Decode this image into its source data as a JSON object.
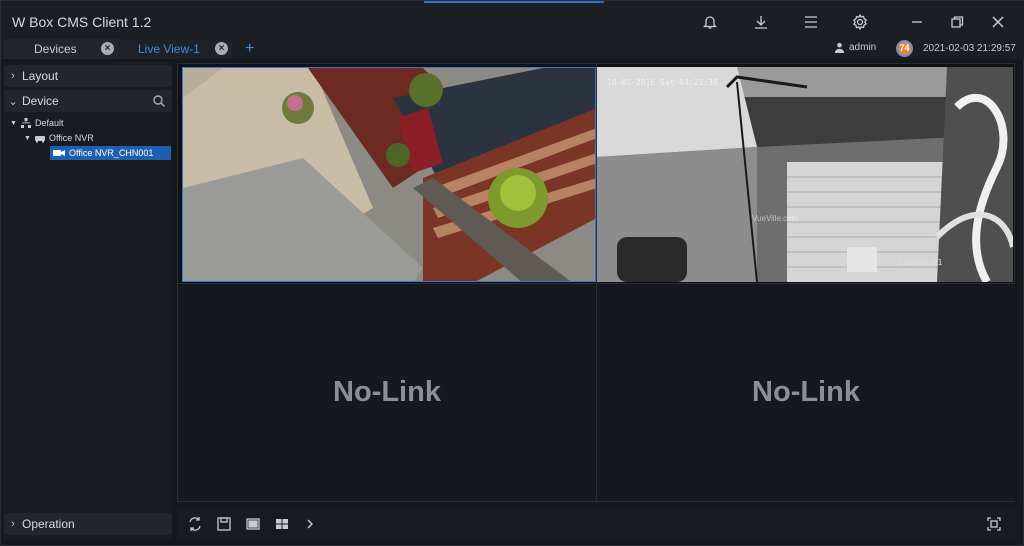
{
  "app": {
    "title": "W Box CMS Client 1.2"
  },
  "tabs": [
    {
      "label": "Devices"
    },
    {
      "label": "Live View-1"
    }
  ],
  "tab_add_label": "+",
  "user": {
    "name": "admin",
    "badge": "74",
    "datetime": "2021-02-03 21:29:57"
  },
  "sidebar": {
    "layout_label": "Layout",
    "device_label": "Device",
    "operation_label": "Operation",
    "tree": [
      {
        "label": "Default"
      },
      {
        "label": "Office NVR"
      },
      {
        "label": "Office NVR_CHN001"
      }
    ]
  },
  "views": {
    "cam2_osd": "10-01-2016 Sat 04:21:30",
    "cam2_name": "Camera 01",
    "cam2_watermark": "VueVille.com",
    "nolink_label": "No-Link"
  },
  "colors": {
    "accent": "#3f8ae6",
    "selected": "#1e5fb0",
    "badge": "#e8833a"
  }
}
